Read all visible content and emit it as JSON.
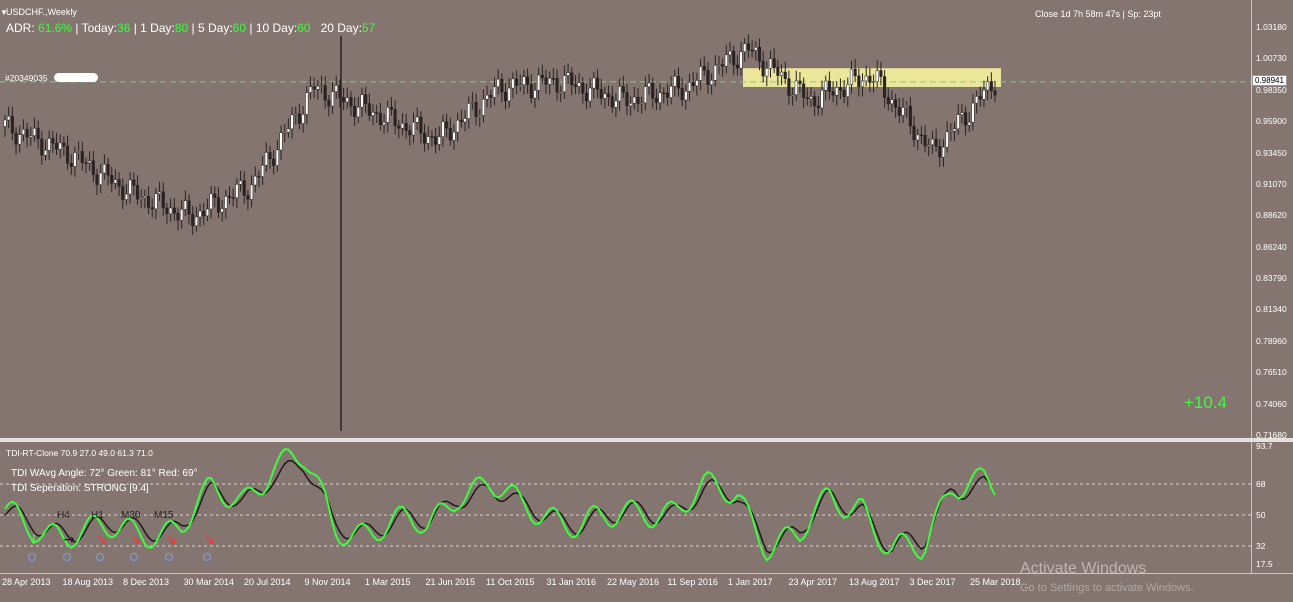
{
  "chart_header": {
    "symbol_title": "USDCHF.,Weekly",
    "adr_label": "ADR:",
    "adr_value": "61.6%",
    "today_label": "| Today:",
    "today_value": "36",
    "day1_label": "| 1 Day:",
    "day1_value": "80",
    "day5_label": "| 5 Day:",
    "day5_value": "60",
    "day10_label": "| 10 Day:",
    "day10_value": "60",
    "day20_label": "20 Day:",
    "day20_value": "57",
    "close_info": "Close 1d 7h 58m 47s | Sp: 23pt",
    "account_label": "#20349035",
    "pips_value": "+10.4"
  },
  "price_axis": {
    "labels": [
      "1.03180",
      "1.00730",
      "0.98350",
      "0.95900",
      "0.93450",
      "0.91070",
      "0.88620",
      "0.86240",
      "0.83790",
      "0.81340",
      "0.78960",
      "0.76510",
      "0.74060",
      "0.71680"
    ],
    "current_price": "0.98941"
  },
  "indicator": {
    "title": "TDI-RT-Clone 70.9 27.0 49.0 61.3 71.0",
    "line1": "TDI WAvg Angle: 72°  Green: 81°  Red: 69°",
    "line2": "TDI Seperation: STRONG [9.4]",
    "timeframes": [
      "H4",
      "H1",
      "M30",
      "M15"
    ],
    "axis_labels": [
      "93.7",
      "68",
      "50",
      "32",
      "17.5"
    ]
  },
  "time_axis": {
    "labels": [
      "28 Apr 2013",
      "18 Aug 2013",
      "8 Dec 2013",
      "30 Mar 2014",
      "20 Jul 2014",
      "9 Nov 2014",
      "1 Mar 2015",
      "21 Jun 2015",
      "11 Oct 2015",
      "31 Jan 2016",
      "22 May 2016",
      "11 Sep 2016",
      "1 Jan 2017",
      "23 Apr 2017",
      "13 Aug 2017",
      "3 Dec 2017",
      "25 Mar 2018"
    ]
  },
  "watermark": {
    "line1": "Activate Windows",
    "line2": "Go to Settings to activate Windows."
  },
  "colors": {
    "background": "#857570",
    "green": "#3dfc3d",
    "highlight_zone": "#f7f3a0"
  },
  "chart_data": {
    "type": "line",
    "x": [
      "28 Apr 2013",
      "18 Aug 2013",
      "8 Dec 2013",
      "30 Mar 2014",
      "20 Jul 2014",
      "9 Nov 2014",
      "1 Mar 2015",
      "21 Jun 2015",
      "11 Oct 2015",
      "31 Jan 2016",
      "22 May 2016",
      "11 Sep 2016",
      "1 Jan 2017",
      "23 Apr 2017",
      "13 Aug 2017",
      "3 Dec 2017",
      "25 Mar 2018"
    ],
    "series": [
      {
        "values": [
          0.955,
          0.935,
          0.905,
          0.885,
          0.91,
          0.985,
          0.965,
          0.945,
          0.985,
          0.99,
          0.975,
          0.985,
          1.015,
          0.975,
          0.995,
          0.935,
          0.99
        ]
      }
    ],
    "ylim": [
      0.7168,
      1.0318
    ]
  }
}
